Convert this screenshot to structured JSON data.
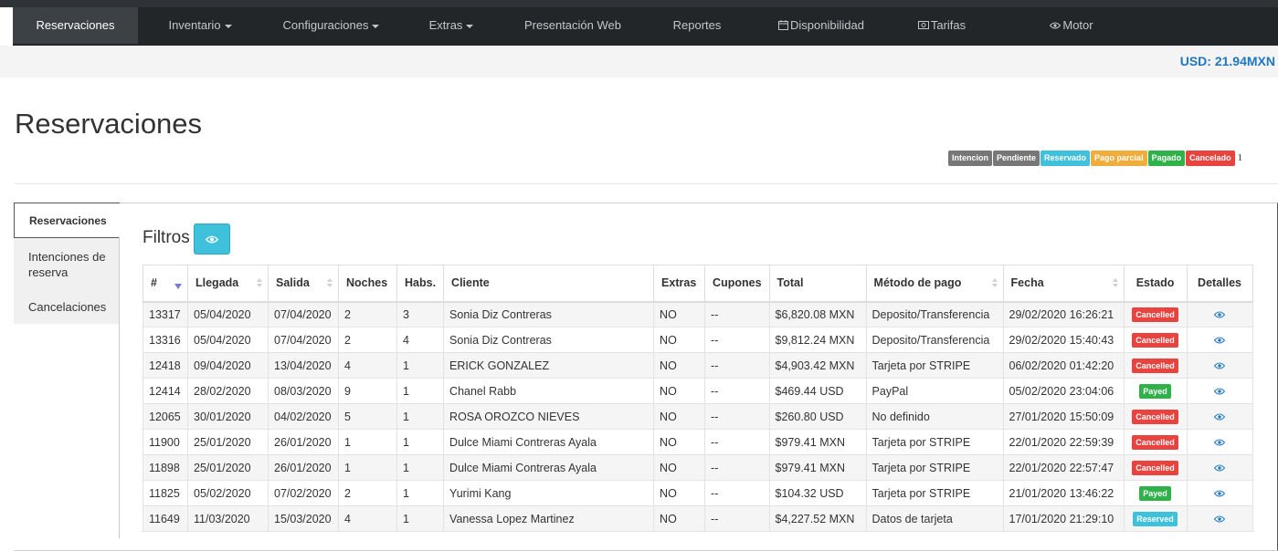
{
  "nav": {
    "items": [
      {
        "label": "Reservaciones",
        "caret": false,
        "icon": ""
      },
      {
        "label": "Inventario",
        "caret": true,
        "icon": ""
      },
      {
        "label": "Configuraciones",
        "caret": true,
        "icon": ""
      },
      {
        "label": "Extras",
        "caret": true,
        "icon": ""
      },
      {
        "label": "Presentación Web",
        "caret": false,
        "icon": ""
      },
      {
        "label": "Reportes",
        "caret": false,
        "icon": ""
      },
      {
        "label": "Disponibilidad",
        "caret": false,
        "icon": "calendar-icon"
      },
      {
        "label": "Tarifas",
        "caret": false,
        "icon": "money-icon"
      },
      {
        "label": "Motor",
        "caret": false,
        "icon": "eye-icon"
      }
    ]
  },
  "currency": "USD: 21.94MXN",
  "page_title": "Reservaciones",
  "legend": {
    "items": [
      {
        "label": "Intencion",
        "color": "#777777"
      },
      {
        "label": "Pendiente",
        "color": "#777777"
      },
      {
        "label": "Reservado",
        "color": "#3fc1dc"
      },
      {
        "label": "Pago parcial",
        "color": "#f0ad3b"
      },
      {
        "label": "Pagado",
        "color": "#2fb24a"
      },
      {
        "label": "Cancelado",
        "color": "#e8433f"
      }
    ],
    "trailing": "1"
  },
  "sidebar": {
    "items": [
      {
        "label": "Reservaciones"
      },
      {
        "label": "Intenciones de reserva"
      },
      {
        "label": "Cancelaciones"
      }
    ]
  },
  "filters": {
    "title": "Filtros"
  },
  "table": {
    "headers": [
      "#",
      "Llegada",
      "Salida",
      "Noches",
      "Habs.",
      "Cliente",
      "Extras",
      "Cupones",
      "Total",
      "Método de pago",
      "Fecha",
      "Estado",
      "Detalles"
    ],
    "rows": [
      {
        "id": "13317",
        "llegada": "05/04/2020",
        "salida": "07/04/2020",
        "noches": "2",
        "habs": "3",
        "cliente": "Sonia Diz Contreras",
        "extras": "NO",
        "cupones": "--",
        "total": "$6,820.08 MXN",
        "metodo": "Deposito/Transferencia",
        "fecha": "29/02/2020 16:26:21",
        "estado": "Cancelled",
        "estado_color": "#e8433f"
      },
      {
        "id": "13316",
        "llegada": "05/04/2020",
        "salida": "07/04/2020",
        "noches": "2",
        "habs": "4",
        "cliente": "Sonia Diz Contreras",
        "extras": "NO",
        "cupones": "--",
        "total": "$9,812.24 MXN",
        "metodo": "Deposito/Transferencia",
        "fecha": "29/02/2020 15:40:43",
        "estado": "Cancelled",
        "estado_color": "#e8433f"
      },
      {
        "id": "12418",
        "llegada": "09/04/2020",
        "salida": "13/04/2020",
        "noches": "4",
        "habs": "1",
        "cliente": "ERICK GONZALEZ",
        "extras": "NO",
        "cupones": "--",
        "total": "$4,903.42 MXN",
        "metodo": "Tarjeta por STRIPE",
        "fecha": "06/02/2020 01:42:20",
        "estado": "Cancelled",
        "estado_color": "#e8433f"
      },
      {
        "id": "12414",
        "llegada": "28/02/2020",
        "salida": "08/03/2020",
        "noches": "9",
        "habs": "1",
        "cliente": "Chanel Rabb",
        "extras": "NO",
        "cupones": "--",
        "total": "$469.44 USD",
        "metodo": "PayPal",
        "fecha": "05/02/2020 23:04:06",
        "estado": "Payed",
        "estado_color": "#2fb24a"
      },
      {
        "id": "12065",
        "llegada": "30/01/2020",
        "salida": "04/02/2020",
        "noches": "5",
        "habs": "1",
        "cliente": "ROSA OROZCO NIEVES",
        "extras": "NO",
        "cupones": "--",
        "total": "$260.80 USD",
        "metodo": "No definido",
        "fecha": "27/01/2020 15:50:09",
        "estado": "Cancelled",
        "estado_color": "#e8433f"
      },
      {
        "id": "11900",
        "llegada": "25/01/2020",
        "salida": "26/01/2020",
        "noches": "1",
        "habs": "1",
        "cliente": "Dulce Miami Contreras Ayala",
        "extras": "NO",
        "cupones": "--",
        "total": "$979.41 MXN",
        "metodo": "Tarjeta por STRIPE",
        "fecha": "22/01/2020 22:59:39",
        "estado": "Cancelled",
        "estado_color": "#e8433f"
      },
      {
        "id": "11898",
        "llegada": "25/01/2020",
        "salida": "26/01/2020",
        "noches": "1",
        "habs": "1",
        "cliente": "Dulce Miami Contreras Ayala",
        "extras": "NO",
        "cupones": "--",
        "total": "$979.41 MXN",
        "metodo": "Tarjeta por STRIPE",
        "fecha": "22/01/2020 22:57:47",
        "estado": "Cancelled",
        "estado_color": "#e8433f"
      },
      {
        "id": "11825",
        "llegada": "05/02/2020",
        "salida": "07/02/2020",
        "noches": "2",
        "habs": "1",
        "cliente": "Yurimi Kang",
        "extras": "NO",
        "cupones": "--",
        "total": "$104.32 USD",
        "metodo": "Tarjeta por STRIPE",
        "fecha": "21/01/2020 13:46:22",
        "estado": "Payed",
        "estado_color": "#2fb24a"
      },
      {
        "id": "11649",
        "llegada": "11/03/2020",
        "salida": "15/03/2020",
        "noches": "4",
        "habs": "1",
        "cliente": "Vanessa Lopez Martinez",
        "extras": "NO",
        "cupones": "--",
        "total": "$4,227.52 MXN",
        "metodo": "Datos de tarjeta",
        "fecha": "17/01/2020 21:29:10",
        "estado": "Reserved",
        "estado_color": "#3fc1dc"
      }
    ]
  }
}
